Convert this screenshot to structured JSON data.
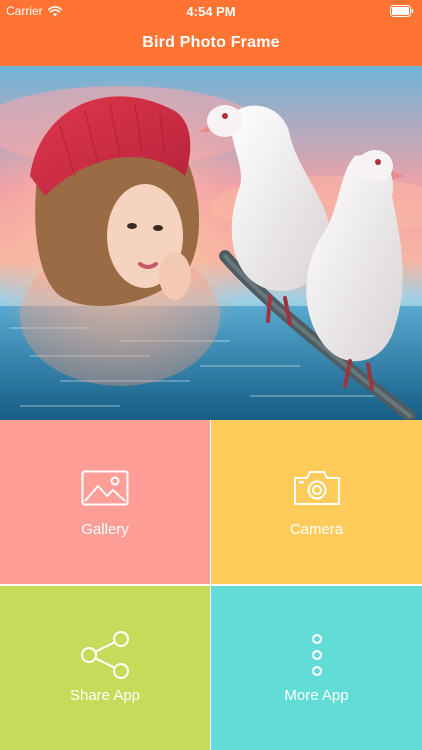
{
  "status_bar": {
    "carrier": "Carrier",
    "time": "4:54 PM",
    "wifi_icon": "wifi-icon",
    "battery_icon": "battery-icon"
  },
  "nav": {
    "title": "Bird Photo Frame"
  },
  "hero": {
    "description_icon": "photo-frame-preview"
  },
  "tiles": [
    {
      "label": "Gallery",
      "icon": "gallery-icon",
      "color": "#ff9d97"
    },
    {
      "label": "Camera",
      "icon": "camera-icon",
      "color": "#ffcc5c"
    },
    {
      "label": "Share App",
      "icon": "share-icon",
      "color": "#c5dc5a"
    },
    {
      "label": "More App",
      "icon": "more-vertical-icon",
      "color": "#61dcd6"
    }
  ],
  "colors": {
    "nav_bar": "#ff7433",
    "text": "#ffffff"
  }
}
